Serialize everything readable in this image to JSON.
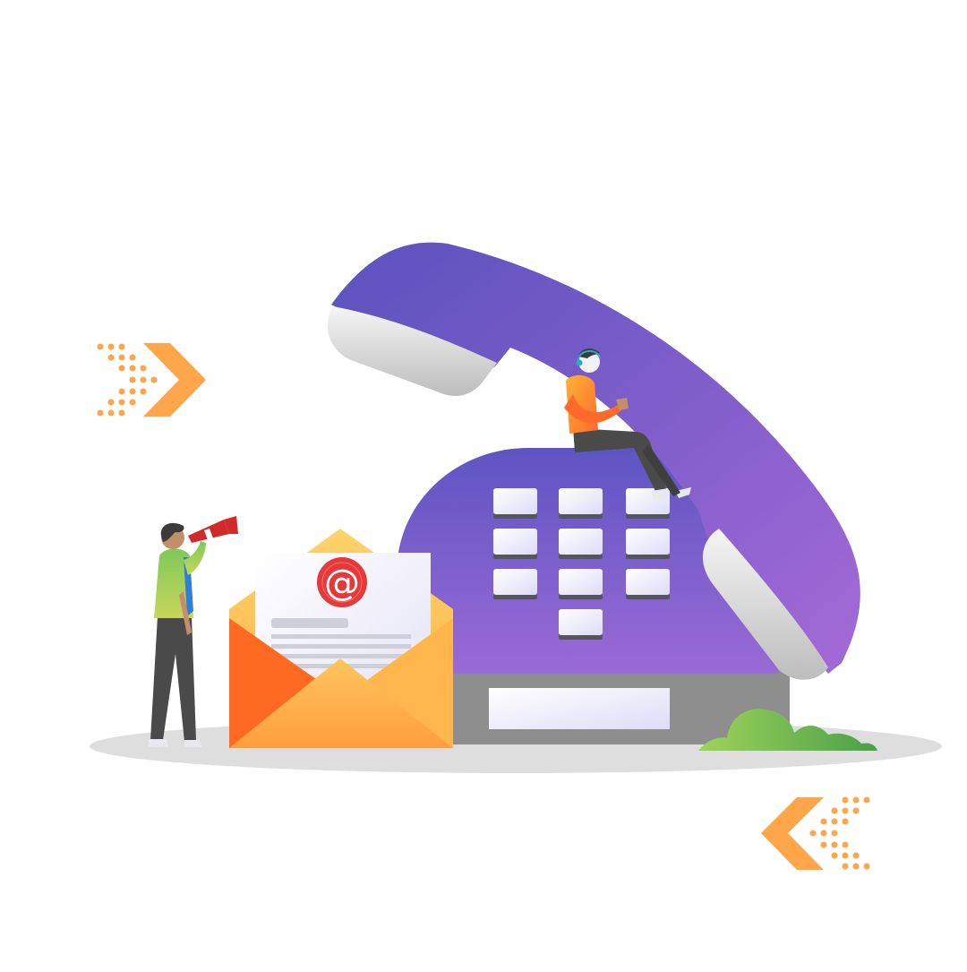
{
  "illustration": {
    "subject": "contact-us",
    "at_symbol": "@",
    "colors": {
      "background": "#ffffff",
      "phone_purple_dark": "#5b52bd",
      "phone_purple_light": "#9b67d4",
      "phone_base_gray": "#8c8c8c",
      "key_light": "#f1f0ff",
      "envelope_orange": "#ff8a3d",
      "envelope_yellow": "#ffc65c",
      "email_badge_red": "#e63a3a",
      "ground_shadow": "#dcdcdc",
      "bush_green": "#6dbb4f",
      "arrow_orange": "#ffa54a"
    },
    "icons": [
      "telephone-icon",
      "envelope-icon",
      "at-sign-icon",
      "megaphone-icon",
      "headset-icon",
      "chevron-right-icon",
      "chevron-left-icon"
    ]
  }
}
